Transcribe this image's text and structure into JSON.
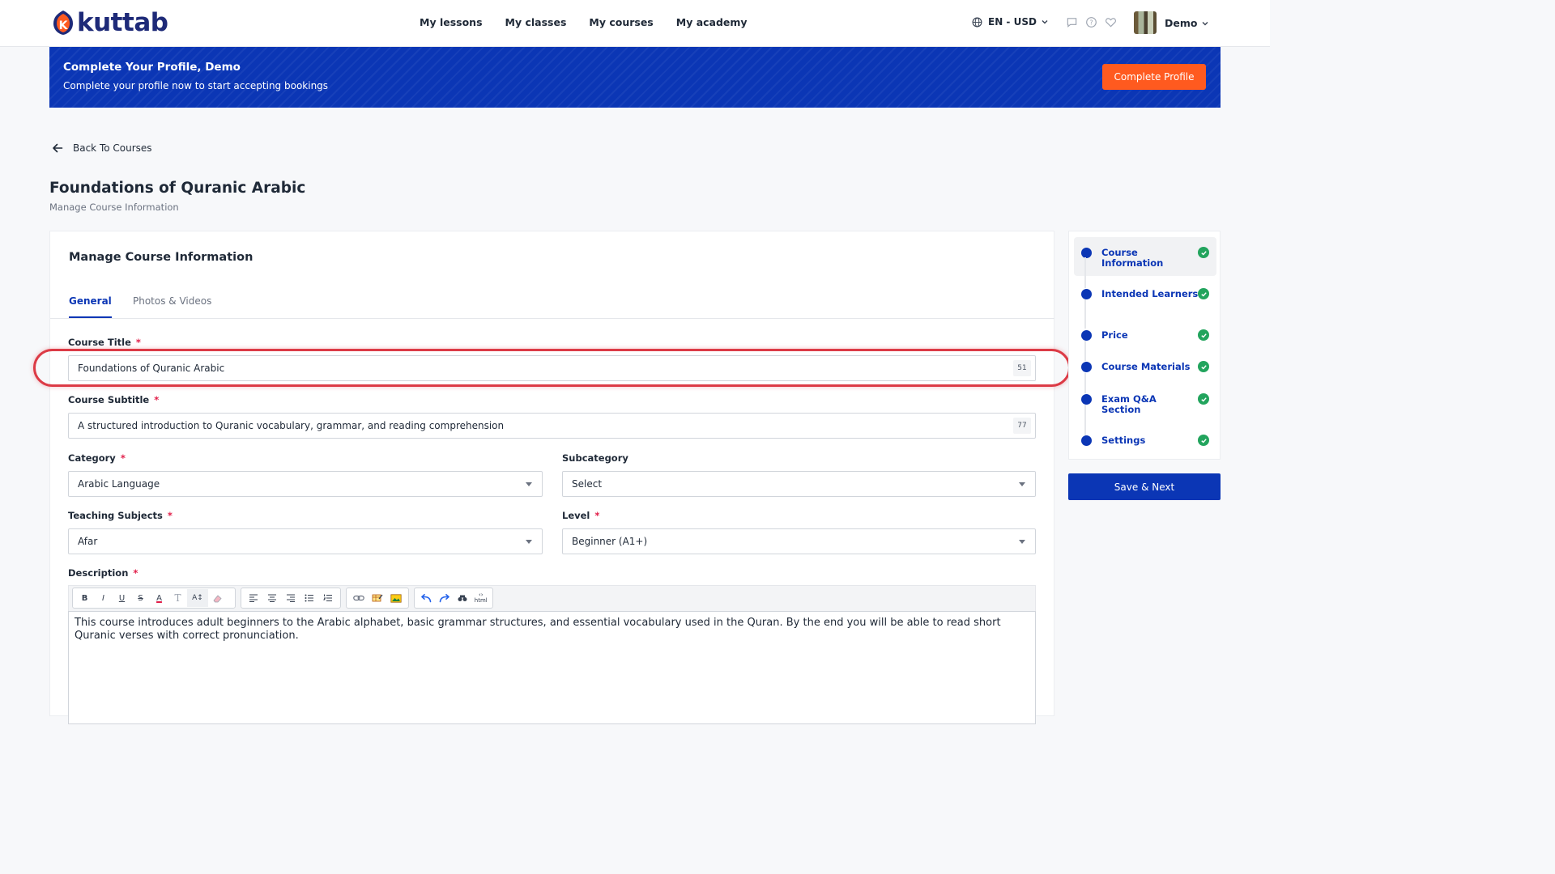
{
  "header": {
    "logo_text": "kuttab",
    "nav": [
      "My lessons",
      "My classes",
      "My courses",
      "My academy"
    ],
    "lang": "EN - USD",
    "user": "Demo"
  },
  "banner": {
    "title": "Complete Your Profile, Demo",
    "subtitle": "Complete your profile now to start accepting bookings",
    "button": "Complete Profile"
  },
  "back_label": "Back To Courses",
  "page": {
    "title": "Foundations of Quranic Arabic",
    "subtitle": "Manage Course Information"
  },
  "card": {
    "title": "Manage Course Information",
    "tabs": [
      "General",
      "Photos & Videos"
    ]
  },
  "form": {
    "course_title": {
      "label": "Course Title",
      "value": "Foundations of Quranic Arabic",
      "counter": "51"
    },
    "course_subtitle": {
      "label": "Course Subtitle",
      "value": "A structured introduction to Quranic vocabulary, grammar, and reading comprehension",
      "counter": "77"
    },
    "category": {
      "label": "Category",
      "value": "Arabic Language"
    },
    "subcategory": {
      "label": "Subcategory",
      "value": "Select"
    },
    "teaching_subjects": {
      "label": "Teaching Subjects",
      "value": "Afar"
    },
    "level": {
      "label": "Level",
      "value": "Beginner (A1+)"
    },
    "description": {
      "label": "Description",
      "value": "This course introduces adult beginners to the Arabic alphabet, basic grammar structures, and essential vocabulary used in the Quran. By the end you will be able to read short Quranic verses with correct pronunciation."
    },
    "required_mark": "*"
  },
  "toolbar": {
    "bold": "B",
    "italic": "I",
    "underline": "U",
    "strike": "S",
    "font_color": "A",
    "format": "T",
    "font_size": "A↕",
    "html": "html"
  },
  "steps": [
    {
      "label": "Course Information",
      "done": true
    },
    {
      "label": "Intended Learners",
      "done": true
    },
    {
      "label": "Price",
      "done": true
    },
    {
      "label": "Course Materials",
      "done": true
    },
    {
      "label": "Exam Q&A Section",
      "done": true
    },
    {
      "label": "Settings",
      "done": true
    }
  ],
  "save_next": "Save & Next",
  "colors": {
    "primary": "#0b36b5",
    "accent": "#ff5a1f",
    "success": "#22a45d",
    "highlight": "#dc3b46"
  }
}
